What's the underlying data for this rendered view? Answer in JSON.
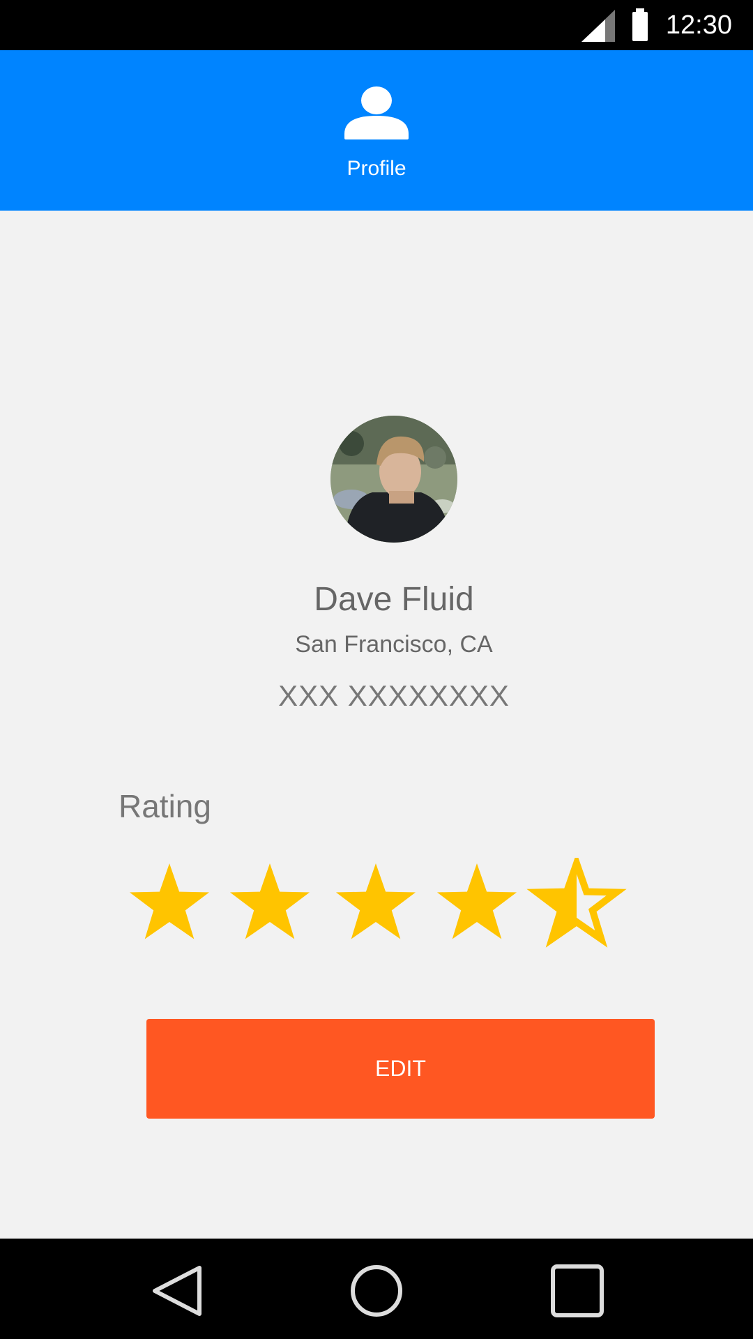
{
  "status_bar": {
    "time": "12:30",
    "icons": [
      "cellular-signal-icon",
      "battery-icon"
    ]
  },
  "app_bar": {
    "icon": "person-icon",
    "title": "Profile",
    "color": "#0084ff"
  },
  "profile": {
    "avatar": "profile-photo",
    "name": "Dave Fluid",
    "location": "San Francisco, CA",
    "phone": "XXX XXXXXXXX"
  },
  "rating": {
    "label": "Rating",
    "value": 4.5,
    "max": 5,
    "star_color": "#ffc400"
  },
  "edit_button": {
    "label": "EDIT",
    "color": "#ff5722"
  },
  "nav_bar": {
    "buttons": [
      "back-icon",
      "home-icon",
      "recents-icon"
    ]
  }
}
